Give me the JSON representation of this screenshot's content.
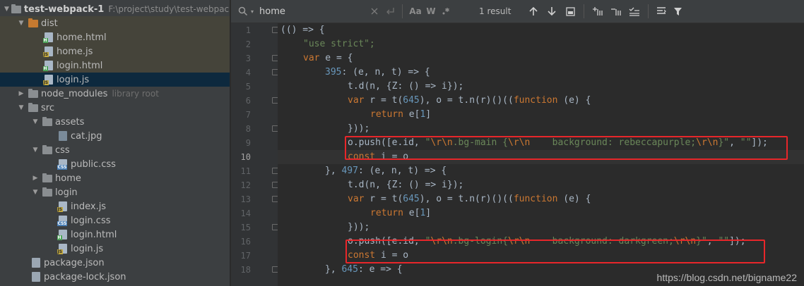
{
  "project_tree": {
    "root": {
      "name": "test-webpack-1",
      "path": "F:\\project\\study\\test-webpack-"
    },
    "items": [
      {
        "label": "dist",
        "type": "folder-orange"
      },
      {
        "label": "home.html",
        "type": "html"
      },
      {
        "label": "home.js",
        "type": "js"
      },
      {
        "label": "login.html",
        "type": "html"
      },
      {
        "label": "login.js",
        "type": "js"
      },
      {
        "label": "node_modules",
        "hint": "library root",
        "type": "folder"
      },
      {
        "label": "src",
        "type": "folder"
      },
      {
        "label": "assets",
        "type": "folder"
      },
      {
        "label": "cat.jpg",
        "type": "img"
      },
      {
        "label": "css",
        "type": "folder"
      },
      {
        "label": "public.css",
        "type": "css"
      },
      {
        "label": "home",
        "type": "folder"
      },
      {
        "label": "login",
        "type": "folder"
      },
      {
        "label": "index.js",
        "type": "js"
      },
      {
        "label": "login.css",
        "type": "css"
      },
      {
        "label": "login.html",
        "type": "html"
      },
      {
        "label": "login.js",
        "type": "js"
      },
      {
        "label": "package.json",
        "type": "json"
      },
      {
        "label": "package-lock.json",
        "type": "json"
      }
    ]
  },
  "search": {
    "query": "home",
    "result_count": "1 result",
    "match_case_label": "Aa",
    "words_label": "W",
    "regex_label": ".*"
  },
  "editor": {
    "line_numbers": [
      "1",
      "2",
      "3",
      "4",
      "5",
      "6",
      "7",
      "8",
      "9",
      "10",
      "11",
      "12",
      "13",
      "14",
      "15",
      "16",
      "17",
      "18"
    ],
    "current_line": 10,
    "lines": [
      "(() => {",
      "\"use strict\";",
      "var e = {",
      "395: (e, n, t) => {",
      "t.d(n, {Z: () => i});",
      "var r = t(645), o = t.n(r)()((function (e) {",
      "return e[1]",
      "}));",
      "o.push([e.id, \"\\r\\n.bg-main {\\r\\n    background: rebeccapurple;\\r\\n}\", \"\"]);",
      "const i = o",
      "}, 497: (e, n, t) => {",
      "t.d(n, {Z: () => i});",
      "var r = t(645), o = t.n(r)()((function (e) {",
      "return e[1]",
      "}));",
      "o.push([e.id, \"\\r\\n.bg-login{\\r\\n    background: darkgreen;\\r\\n}\", \"\"]);",
      "const i = o",
      "}, 645: e => {"
    ]
  },
  "watermark": "https://blog.csdn.net/bigname22",
  "colors": {
    "highlight_box": "#e8262a"
  }
}
